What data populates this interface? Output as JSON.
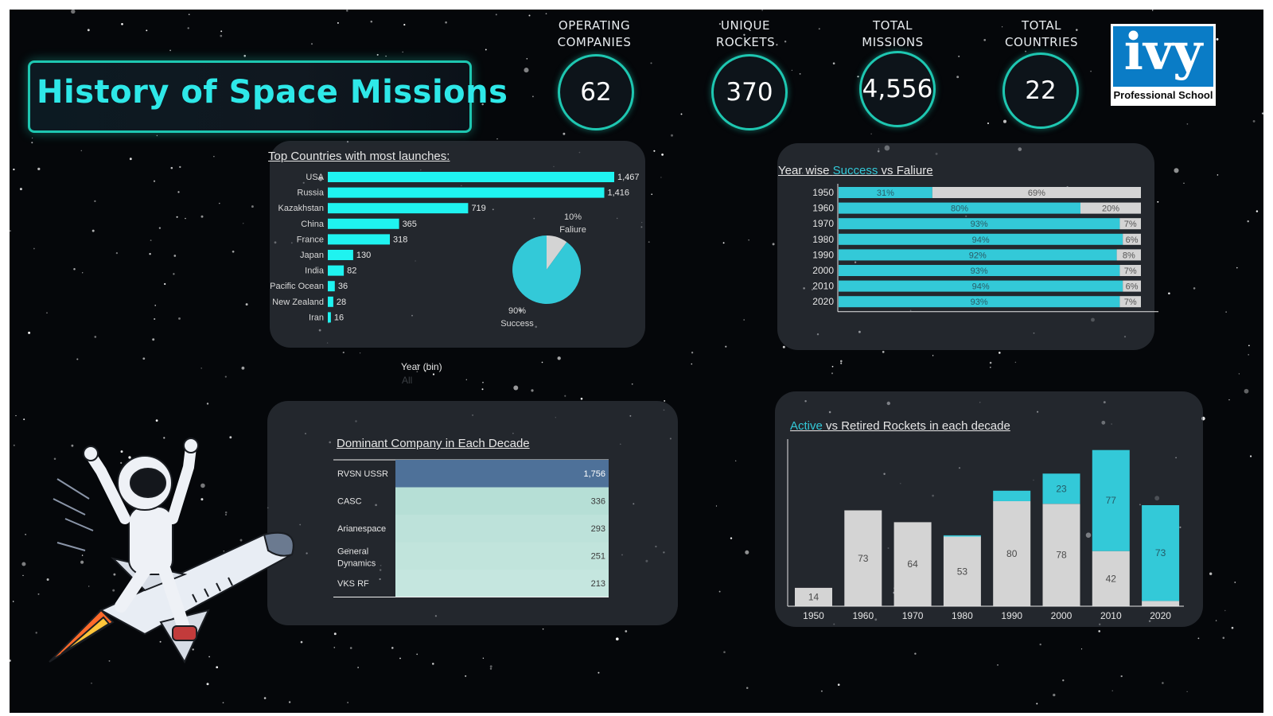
{
  "dashboard": {
    "title": "History of Space Missions",
    "kpis": [
      {
        "label_line1": "OPERATING",
        "label_line2": "COMPANIES",
        "value": "62"
      },
      {
        "label_line1": "UNIQUE",
        "label_line2": "ROCKETS",
        "value": "370"
      },
      {
        "label_line1": "TOTAL",
        "label_line2": "MISSIONS",
        "value": "4,556"
      },
      {
        "label_line1": "TOTAL",
        "label_line2": "COUNTRIES",
        "value": "22"
      }
    ],
    "logo": {
      "word": "ivy",
      "tagline": "Professional School"
    },
    "filter": {
      "label": "Year (bin)",
      "value": "All"
    },
    "panels": {
      "countries_title": "Top Countries with most launches:",
      "success_title_a": "Year wise ",
      "success_title_b": "Success",
      "success_title_c": " vs Faliure",
      "dominant_title": "Dominant Company in Each Decade",
      "rockets_title_a": "Active",
      "rockets_title_b": " vs Retired Rockets in each decade"
    },
    "colors": {
      "accent": "#33c9d8",
      "bar_cyan": "#1ff3f0",
      "grey": "#d4d4d4",
      "table_dark": "#4e7199",
      "table_light": "#c5e6df"
    }
  },
  "chart_data": [
    {
      "type": "bar",
      "orientation": "horizontal",
      "title": "Top Countries with most launches:",
      "categories": [
        "USA",
        "Russia",
        "Kazakhstan",
        "China",
        "France",
        "Japan",
        "India",
        "Pacific Ocean",
        "New Zealand",
        "Iran"
      ],
      "values": [
        1467,
        1416,
        719,
        365,
        318,
        130,
        82,
        36,
        28,
        16
      ],
      "value_labels": [
        "1,467",
        "1,416",
        "719",
        "365",
        "318",
        "130",
        "82",
        "36",
        "28",
        "16"
      ]
    },
    {
      "type": "pie",
      "slices": [
        {
          "name": "Success",
          "value": 90,
          "label": "90%"
        },
        {
          "name": "Faliure",
          "value": 10,
          "label": "10%"
        }
      ]
    },
    {
      "type": "bar",
      "orientation": "horizontal",
      "stacked": "percent",
      "title": "Year wise Success vs Faliure",
      "categories": [
        "1950",
        "1960",
        "1970",
        "1980",
        "1990",
        "2000",
        "2010",
        "2020"
      ],
      "series": [
        {
          "name": "Success",
          "values": [
            31,
            80,
            93,
            94,
            92,
            93,
            94,
            93
          ]
        },
        {
          "name": "Faliure",
          "values": [
            69,
            20,
            7,
            6,
            8,
            7,
            6,
            7
          ]
        }
      ]
    },
    {
      "type": "table",
      "title": "Dominant Company in Each Decade",
      "rows": [
        {
          "company_line1": "RVSN USSR",
          "company_line2": "",
          "value": "1,756"
        },
        {
          "company_line1": "CASC",
          "company_line2": "",
          "value": "336"
        },
        {
          "company_line1": "Arianespace",
          "company_line2": "",
          "value": "293"
        },
        {
          "company_line1": "General",
          "company_line2": "Dynamics",
          "value": "251"
        },
        {
          "company_line1": "VKS RF",
          "company_line2": "",
          "value": "213"
        }
      ]
    },
    {
      "type": "bar",
      "stacked": true,
      "title": "Active vs Retired Rockets in each decade",
      "categories": [
        "1950",
        "1960",
        "1970",
        "1980",
        "1990",
        "2000",
        "2010",
        "2020"
      ],
      "series": [
        {
          "name": "Retired",
          "values": [
            14,
            73,
            64,
            53,
            80,
            78,
            42,
            4
          ]
        },
        {
          "name": "Active",
          "values": [
            0,
            0,
            0,
            1,
            8,
            23,
            77,
            73
          ]
        }
      ],
      "data_labels": {
        "Retired": [
          "14",
          "73",
          "64",
          "53",
          "80",
          "78",
          "42",
          ""
        ],
        "Active": [
          "",
          "",
          "",
          "",
          "",
          "23",
          "77",
          "73"
        ]
      }
    }
  ]
}
